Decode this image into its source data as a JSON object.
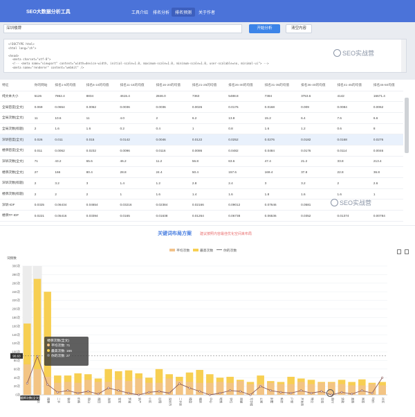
{
  "header": {
    "app_title": "SEO大数据分析工具",
    "nav": [
      "工具介绍",
      "排名分析",
      "排名预测",
      "关于作者"
    ]
  },
  "search": {
    "value": "深圳楼牌",
    "analyze_label": "开始分析",
    "clear_label": "清空内容"
  },
  "code_lines": [
    "<!DOCTYPE html>",
    "<html lang=\"zh\">",
    "",
    "<head>",
    "  <meta charset=\"utf-8\">",
    "  <!-- <meta name=\"viewport\" content=\"width=device-width, initial-scale=1.0, maximum-scale=1.0, minimum-scale=1.0, user-scalable=no, minimal-ui\"> -->",
    "  <meta name=\"renderer\" content=\"webkit\" />"
  ],
  "watermark_text": "SEO实战营",
  "table": {
    "headers": [
      "特征",
      "你的网站",
      "排名1-5的均值",
      "排名6-10的均值",
      "排名11-15的均值",
      "排名16-20的均值",
      "排名21-25的均值",
      "排名26-30的均值",
      "排名31-35的均值",
      "排名36-40的均值",
      "排名41-45的均值",
      "排名46-50均值"
    ],
    "rows": [
      [
        "纯文本大小",
        "5126",
        "7862.4",
        "8834",
        "4615.4",
        "2846.0",
        "7363",
        "5488.8",
        "7384",
        "3753.6",
        "4142",
        "16671.4"
      ],
      [
        "全局密度(全文)",
        "0.069",
        "0.0654",
        "0.0062",
        "0.0036",
        "0.0036",
        "0.0026",
        "0.0176",
        "0.0168",
        "0.009",
        "0.0084",
        "0.0062"
      ],
      [
        "全局次数(全文)",
        "11",
        "10.6",
        "11",
        "4.0",
        "2",
        "6.2",
        "13.8",
        "15.2",
        "6.4",
        "7.6",
        "6.6"
      ],
      [
        "全局次数(标题)",
        "2",
        "1.6",
        "1.6",
        "0.2",
        "0.4",
        "1",
        "0.8",
        "1.6",
        "1.2",
        "0.6",
        "8"
      ],
      [
        "深圳密度(全文)",
        "0.026",
        "0.011",
        "0.015",
        "0.0142",
        "0.0046",
        "0.0122",
        "0.0252",
        "0.0276",
        "0.0182",
        "0.0168",
        "0.0276"
      ],
      [
        "楼牌密度(全文)",
        "0.011",
        "0.0062",
        "0.0232",
        "0.0096",
        "0.0116",
        "0.0086",
        "0.0482",
        "0.0484",
        "0.0176",
        "0.0114",
        "0.0046"
      ],
      [
        "深圳次数(全文)",
        "71",
        "43.2",
        "65.6",
        "46.2",
        "11.2",
        "56.8",
        "63.6",
        "47.4",
        "21.2",
        "33.8",
        "213.4"
      ],
      [
        "楼牌次数(全文)",
        "27",
        "166",
        "80.4",
        "28.8",
        "24.4",
        "50.4",
        "157.6",
        "169.4",
        "37.8",
        "22.8",
        "36.8"
      ],
      [
        "深圳次数(标题)",
        "2",
        "3.2",
        "3",
        "1.4",
        "1.2",
        "2.8",
        "2.4",
        "3",
        "3.2",
        "2",
        "2.6"
      ],
      [
        "楼牌次数(标题)",
        "2",
        "2",
        "2",
        "1",
        "1.6",
        "1.4",
        "1.6",
        "1.8",
        "1.6",
        "1.6",
        "1"
      ],
      [
        "深圳-IDF",
        "0.0325",
        "0.06434",
        "0.04654",
        "0.03216",
        "0.02384",
        "0.02166",
        "0.09012",
        "0.07646",
        "0.0581",
        "",
        ""
      ],
      [
        "楼牌TF-IDF",
        "0.0221",
        "0.05416",
        "0.03394",
        "0.0165",
        "0.01638",
        "0.01264",
        "0.06738",
        "0.06536",
        "0.0352",
        "0.01374",
        "0.00784"
      ]
    ]
  },
  "chart": {
    "title": "关键词布局方案",
    "subtitle": "建议按照内容最佳优化空间来布局",
    "legend": [
      "平均次数",
      "最高次数",
      "你的次数"
    ],
    "ylabel": "词频数",
    "tooltip": {
      "title": "楼牌次数(全文)",
      "lines": [
        "平均次数: 71",
        "最高次数: 166",
        "你的次数: 27"
      ]
    },
    "marker_label": "90.63",
    "xlabel_first": "楼牌次数(全文)"
  },
  "chart_data": {
    "type": "bar",
    "ylim": [
      0,
      300
    ],
    "yticks": [
      "0次",
      "20次",
      "40次",
      "60次",
      "80次",
      "100次",
      "120次",
      "140次",
      "160次",
      "180次",
      "200次",
      "220次",
      "240次",
      "260次",
      "280次",
      "300次"
    ],
    "categories": [
      "楼牌次数(全文)",
      "深圳",
      "楼牌",
      "二手",
      "装修",
      "价格",
      "南山",
      "福田",
      "龙岗",
      "宝安",
      "罗湖",
      "房产",
      "小区",
      "出租",
      "深圳市",
      "二手房",
      "楼盘",
      "租房",
      "中心",
      "地铁",
      "学位",
      "商铺",
      "写字楼",
      "公寓",
      "别墅",
      "新房",
      "户型",
      "开发商",
      "物业",
      "交易",
      "首付",
      "贷款",
      "政策",
      "网签",
      "均价",
      "片区"
    ],
    "series": [
      {
        "name": "平均次数",
        "values": [
          71,
          60,
          42,
          28,
          30,
          28,
          35,
          30,
          30,
          35,
          32,
          38,
          28,
          28,
          38,
          32,
          30,
          28,
          28,
          30,
          28,
          32,
          25,
          25,
          28,
          25,
          25,
          30,
          25,
          28,
          28,
          25,
          22,
          22,
          25,
          22
        ]
      },
      {
        "name": "最高次数",
        "values": [
          166,
          270,
          240,
          45,
          45,
          50,
          48,
          38,
          60,
          55,
          57,
          50,
          40,
          60,
          48,
          42,
          52,
          58,
          48,
          40,
          42,
          35,
          30,
          45,
          32,
          30,
          42,
          38,
          35,
          30,
          30,
          35,
          30,
          36,
          28,
          30
        ]
      },
      {
        "name": "你的次数",
        "values": [
          27,
          90,
          24,
          6,
          10,
          4,
          8,
          2,
          16,
          10,
          4,
          0,
          6,
          8,
          4,
          26,
          16,
          8,
          0,
          4,
          10,
          8,
          0,
          20,
          10,
          6,
          4,
          10,
          4,
          8,
          0,
          6,
          2,
          10,
          4,
          40
        ]
      }
    ]
  }
}
